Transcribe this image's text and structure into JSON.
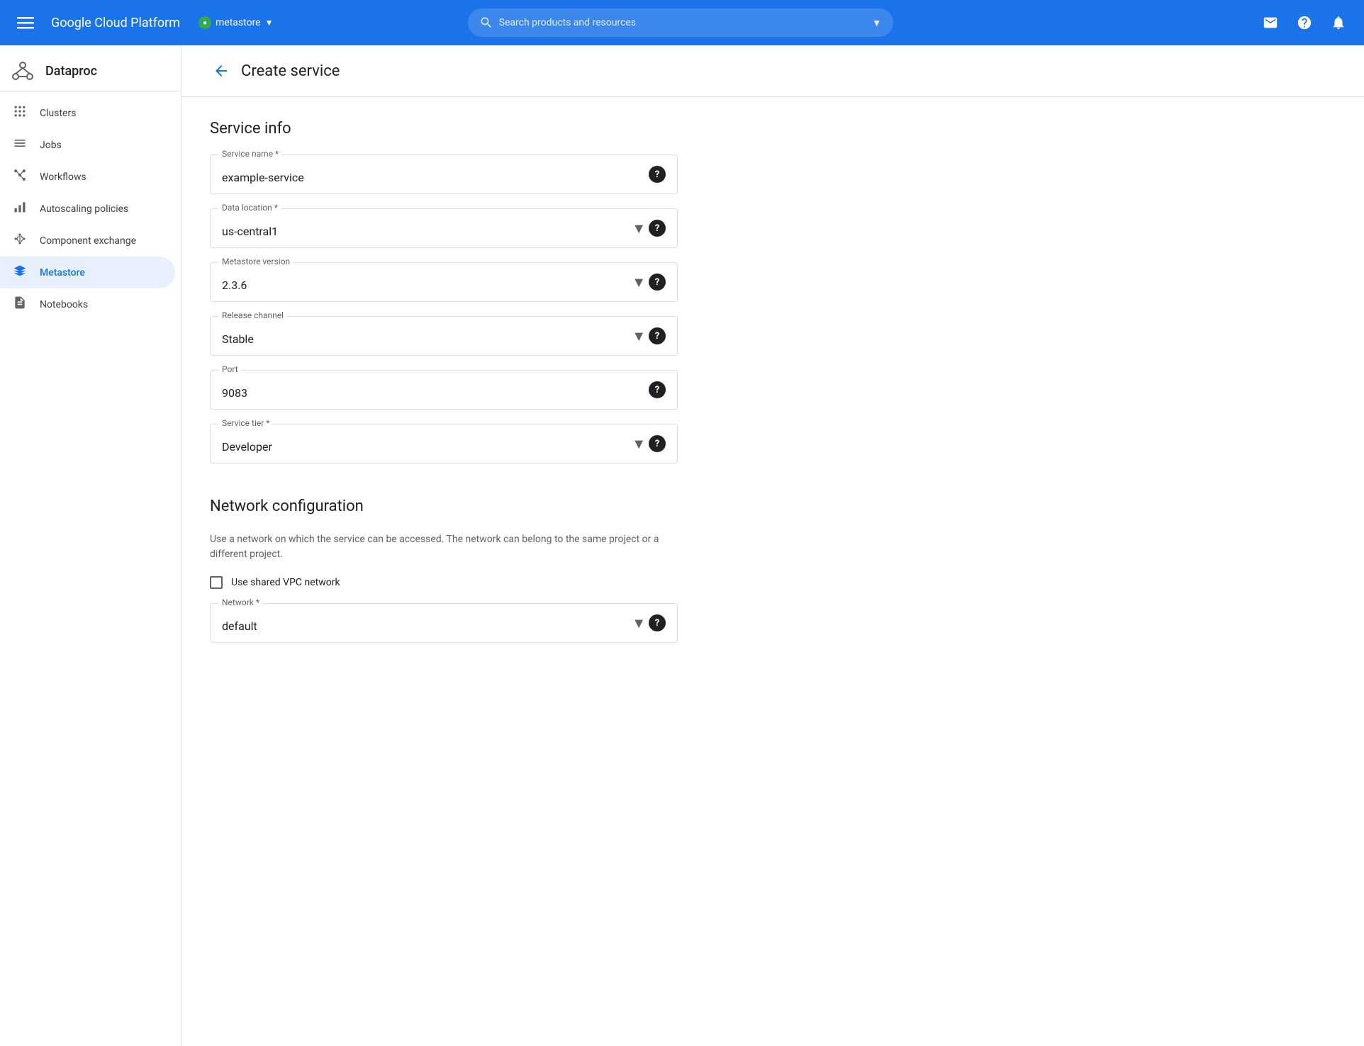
{
  "topNav": {
    "hamburger": "☰",
    "brandTitle": "Google Cloud Platform",
    "project": {
      "name": "metastore",
      "dropdownArrow": "▼"
    },
    "search": {
      "placeholder": "Search products and resources",
      "dropdownArrow": "▼"
    },
    "icons": {
      "support": "□",
      "help": "?",
      "notifications": "🔔"
    }
  },
  "sidebar": {
    "appName": "Dataproc",
    "items": [
      {
        "id": "clusters",
        "label": "Clusters",
        "icon": "clusters"
      },
      {
        "id": "jobs",
        "label": "Jobs",
        "icon": "jobs"
      },
      {
        "id": "workflows",
        "label": "Workflows",
        "icon": "workflows"
      },
      {
        "id": "autoscaling",
        "label": "Autoscaling policies",
        "icon": "autoscaling"
      },
      {
        "id": "component-exchange",
        "label": "Component exchange",
        "icon": "component"
      },
      {
        "id": "metastore",
        "label": "Metastore",
        "icon": "metastore",
        "active": true
      },
      {
        "id": "notebooks",
        "label": "Notebooks",
        "icon": "notebooks"
      }
    ]
  },
  "page": {
    "backButton": "←",
    "title": "Create service"
  },
  "form": {
    "serviceInfoTitle": "Service info",
    "fields": {
      "serviceName": {
        "label": "Service name *",
        "value": "example-service"
      },
      "dataLocation": {
        "label": "Data location *",
        "value": "us-central1",
        "isDropdown": true
      },
      "metastoreVersion": {
        "label": "Metastore version",
        "value": "2.3.6",
        "isDropdown": true
      },
      "releaseChannel": {
        "label": "Release channel",
        "value": "Stable",
        "isDropdown": true
      },
      "port": {
        "label": "Port",
        "value": "9083"
      },
      "serviceTier": {
        "label": "Service tier *",
        "value": "Developer",
        "isDropdown": true
      }
    },
    "networkSection": {
      "title": "Network configuration",
      "description": "Use a network on which the service can be accessed. The network can belong to the same project or a different project.",
      "sharedVpcLabel": "Use shared VPC network",
      "networkField": {
        "label": "Network *",
        "value": "default",
        "isDropdown": true
      }
    }
  }
}
